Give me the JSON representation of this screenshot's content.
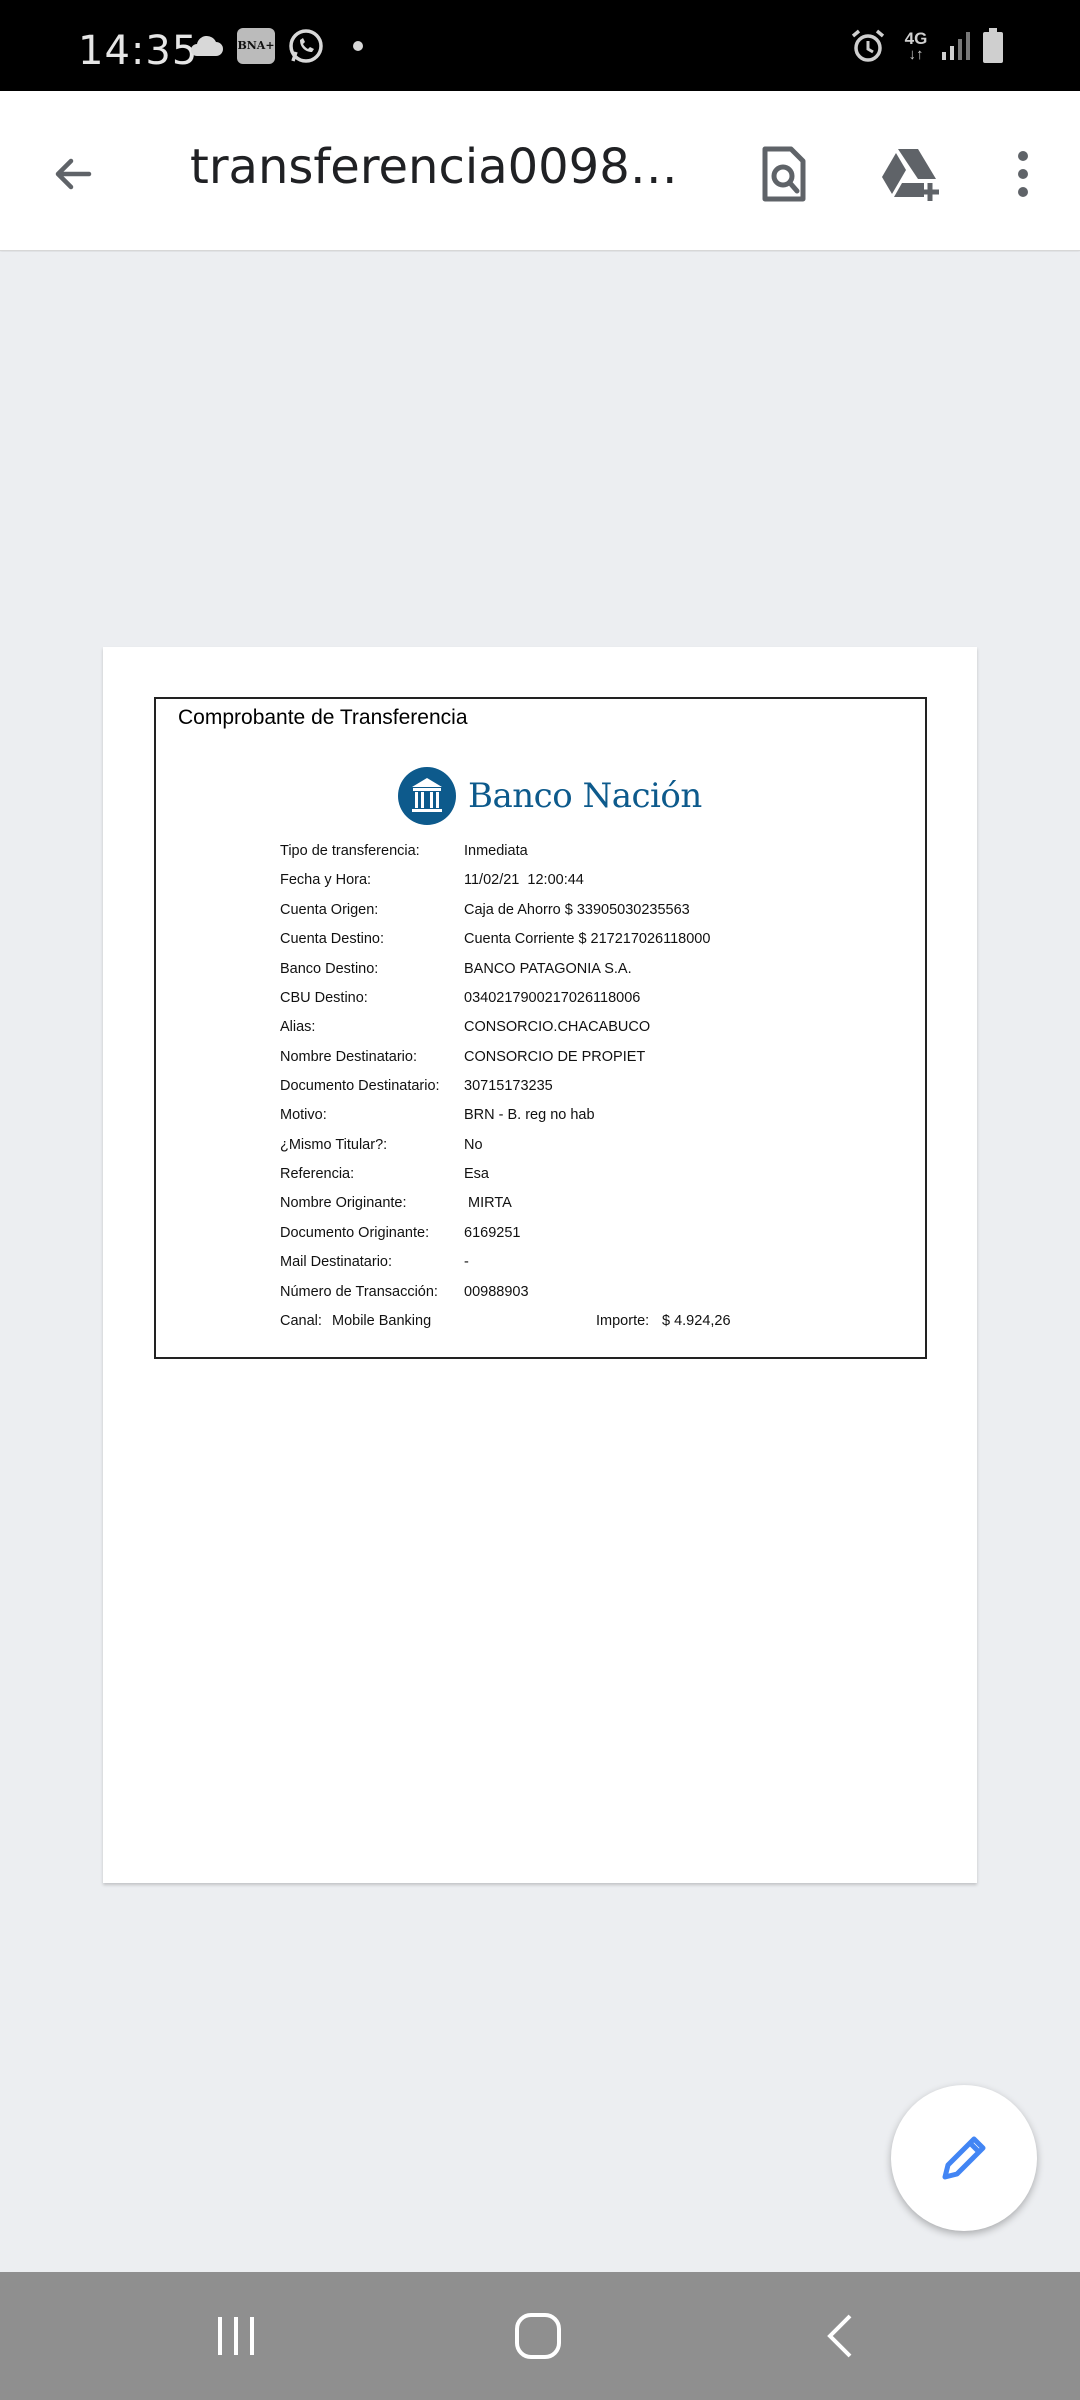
{
  "status_bar": {
    "time": "14:35",
    "network": "4G",
    "notification_icons": [
      "cloud-icon",
      "bna-app-icon",
      "whatsapp-icon",
      "dot-icon"
    ],
    "system_icons": [
      "alarm-icon",
      "network-4g-icon",
      "signal-icon",
      "battery-icon"
    ],
    "bna_badge": "BNA+"
  },
  "app_bar": {
    "title": "transferencia00988...",
    "back_icon": "arrow-back-icon",
    "actions": [
      "find-in-document-icon",
      "add-to-drive-icon",
      "more-options-icon"
    ]
  },
  "receipt": {
    "heading": "Comprobante de Transferencia",
    "bank_name": "Banco Nación",
    "brand_color": "#0d5a8c",
    "rows": [
      {
        "label": "Tipo de transferencia:",
        "value": "Inmediata"
      },
      {
        "label": "Fecha y Hora:",
        "value": "11/02/21  12:00:44"
      },
      {
        "label": "Cuenta Origen:",
        "value": "Caja de Ahorro $ 33905030235563"
      },
      {
        "label": "Cuenta Destino:",
        "value": "Cuenta Corriente $ 217217026118000"
      },
      {
        "label": "Banco Destino:",
        "value": "BANCO PATAGONIA S.A."
      },
      {
        "label": "CBU Destino:",
        "value": "0340217900217026118006"
      },
      {
        "label": "Alias:",
        "value": "CONSORCIO.CHACABUCO"
      },
      {
        "label": "Nombre Destinatario:",
        "value": "CONSORCIO DE PROPIET"
      },
      {
        "label": "Documento Destinatario:",
        "value": "30715173235"
      },
      {
        "label": "Motivo:",
        "value": "BRN - B. reg no hab"
      },
      {
        "label": "¿Mismo Titular?:",
        "value": "No"
      },
      {
        "label": "Referencia:",
        "value": "Esa"
      },
      {
        "label": "Nombre Originante:",
        "value": " MIRTA"
      },
      {
        "label": "Documento Originante:",
        "value": "6169251"
      },
      {
        "label": "Mail Destinatario:",
        "value": "-"
      },
      {
        "label": "Número de Transacción:",
        "value": "00988903"
      }
    ],
    "canal_label": "Canal:",
    "canal_value": "Mobile Banking",
    "importe_label": "Importe:",
    "importe_value": "$ 4.924,26"
  },
  "fab": {
    "icon": "edit-pencil-icon",
    "color": "#4285f4"
  },
  "nav_bar": {
    "buttons": [
      "recent-apps-icon",
      "home-icon",
      "back-nav-icon"
    ]
  }
}
